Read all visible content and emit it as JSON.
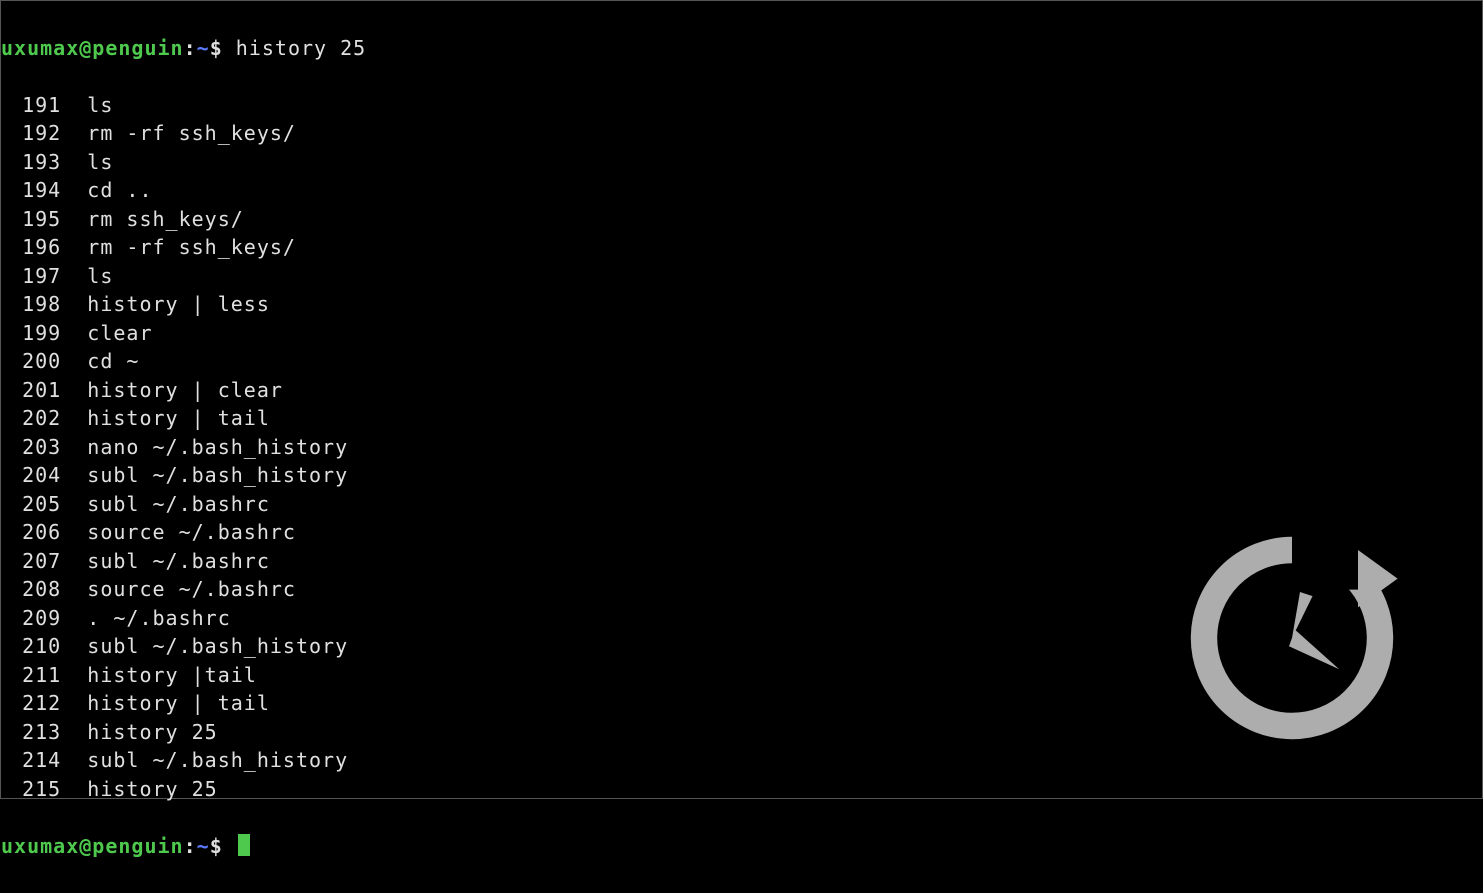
{
  "prompt": {
    "user": "uxumax",
    "at": "@",
    "host": "penguin",
    "colon": ":",
    "path": "~",
    "dollar": "$"
  },
  "first_command": "history 25",
  "history": [
    {
      "n": "191",
      "cmd": "ls"
    },
    {
      "n": "192",
      "cmd": "rm -rf ssh_keys/"
    },
    {
      "n": "193",
      "cmd": "ls"
    },
    {
      "n": "194",
      "cmd": "cd .."
    },
    {
      "n": "195",
      "cmd": "rm ssh_keys/"
    },
    {
      "n": "196",
      "cmd": "rm -rf ssh_keys/"
    },
    {
      "n": "197",
      "cmd": "ls"
    },
    {
      "n": "198",
      "cmd": "history | less"
    },
    {
      "n": "199",
      "cmd": "clear"
    },
    {
      "n": "200",
      "cmd": "cd ~"
    },
    {
      "n": "201",
      "cmd": "history | clear"
    },
    {
      "n": "202",
      "cmd": "history | tail"
    },
    {
      "n": "203",
      "cmd": "nano ~/.bash_history"
    },
    {
      "n": "204",
      "cmd": "subl ~/.bash_history"
    },
    {
      "n": "205",
      "cmd": "subl ~/.bashrc"
    },
    {
      "n": "206",
      "cmd": "source ~/.bashrc"
    },
    {
      "n": "207",
      "cmd": "subl ~/.bashrc"
    },
    {
      "n": "208",
      "cmd": "source ~/.bashrc"
    },
    {
      "n": "209",
      "cmd": ". ~/.bashrc"
    },
    {
      "n": "210",
      "cmd": "subl ~/.bash_history"
    },
    {
      "n": "211",
      "cmd": "history |tail"
    },
    {
      "n": "212",
      "cmd": "history | tail"
    },
    {
      "n": "213",
      "cmd": "history 25"
    },
    {
      "n": "214",
      "cmd": "subl ~/.bash_history"
    },
    {
      "n": "215",
      "cmd": "history 25"
    }
  ],
  "watermark_icon": "history-clock-icon"
}
